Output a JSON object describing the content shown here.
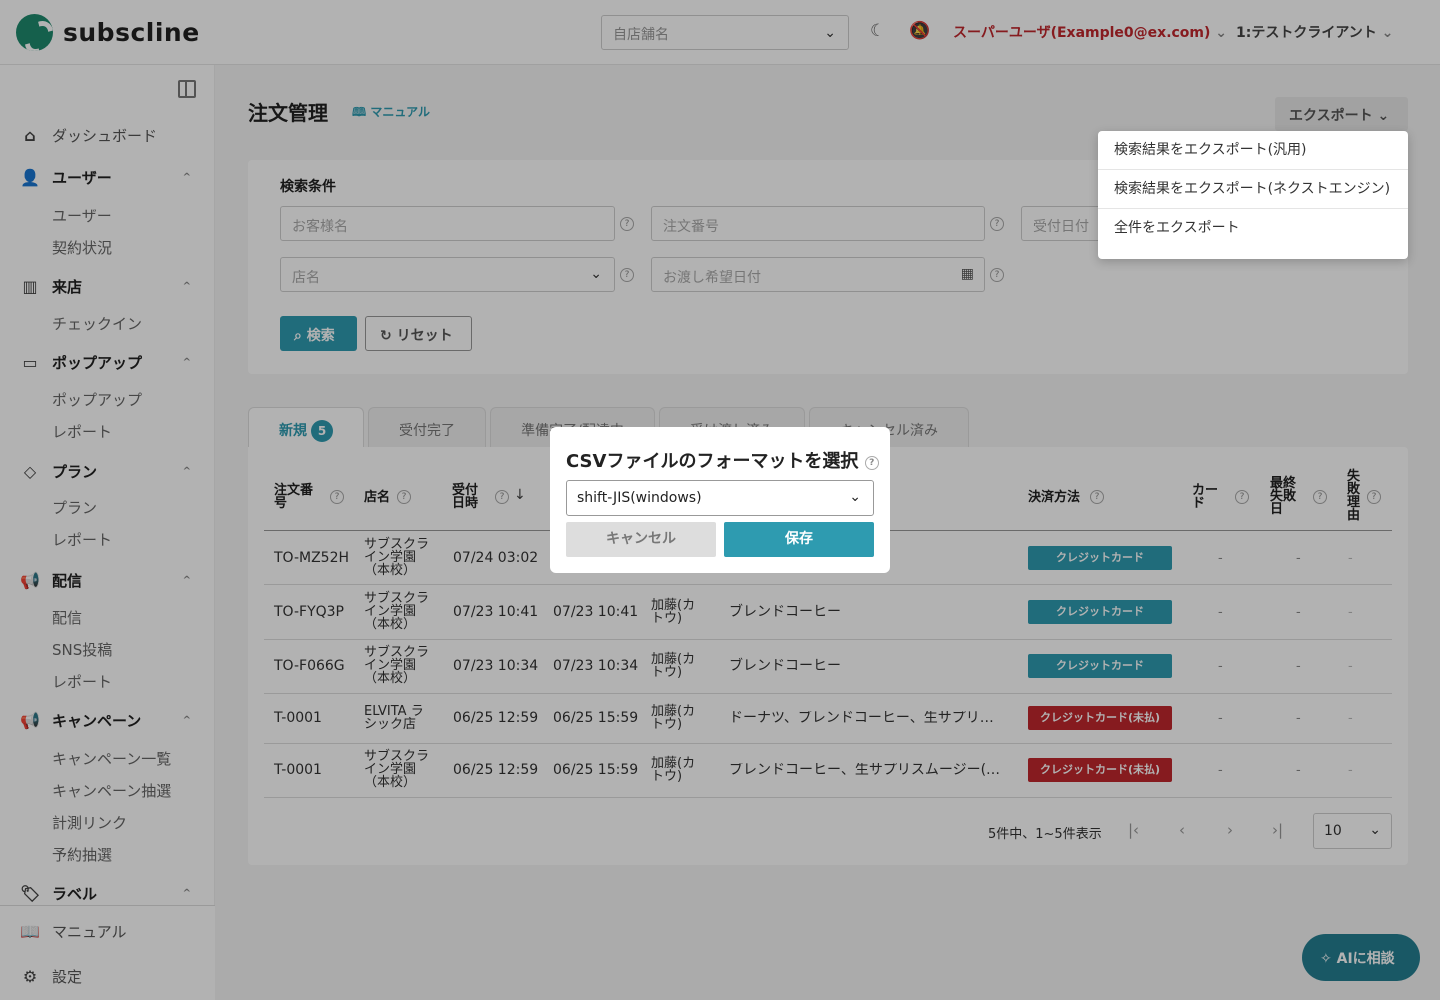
{
  "header": {
    "logo_text": "subscline",
    "store_placeholder": "自店舗名",
    "user_menu": "スーパーユーザ(Example0@ex.com)",
    "client_menu": "1:テストクライアント"
  },
  "sidebar": {
    "dashboard": "ダッシュボード",
    "groups": [
      {
        "label": "ユーザー",
        "items": [
          "ユーザー",
          "契約状況"
        ]
      },
      {
        "label": "来店",
        "items": [
          "チェックイン"
        ]
      },
      {
        "label": "ポップアップ",
        "items": [
          "ポップアップ",
          "レポート"
        ]
      },
      {
        "label": "プラン",
        "items": [
          "プラン",
          "レポート"
        ]
      },
      {
        "label": "配信",
        "items": [
          "配信",
          "SNS投稿",
          "レポート"
        ]
      },
      {
        "label": "キャンペーン",
        "items": [
          "キャンペーン一覧",
          "キャンペーン抽選",
          "計測リンク",
          "予約抽選"
        ]
      },
      {
        "label": "ラベル",
        "items": []
      }
    ],
    "bottom": [
      "マニュアル",
      "設定"
    ]
  },
  "page": {
    "title": "注文管理",
    "manual_link": "マニュアル",
    "export_label": "エクスポート"
  },
  "search": {
    "heading": "検索条件",
    "customer_placeholder": "お客様名",
    "order_no_placeholder": "注文番号",
    "received_date_placeholder": "受付日付",
    "store_placeholder": "店名",
    "pickup_date_placeholder": "お渡し希望日付",
    "search_button": "検索",
    "reset_button": "リセット"
  },
  "tabs": [
    {
      "label": "新規",
      "count": "5"
    },
    {
      "label": "受付完了"
    },
    {
      "label": "準備完了/配達中"
    },
    {
      "label": "受け渡し済み"
    },
    {
      "label": "キャンセル済み"
    }
  ],
  "table": {
    "headers": {
      "order_no": "注文番号",
      "store": "店名",
      "received": "受付日時",
      "payment": "決済方法",
      "card": "カード",
      "last_fail": "最終失敗日",
      "fail_reason": "失敗理由"
    },
    "rows": [
      {
        "order_no": "TO-MZ52H",
        "store": "サブスクライン学園（本校）",
        "received": "07/24 03:02",
        "pickup": "",
        "customer": "",
        "items": "",
        "payment": "クレジットカード",
        "status": "teal",
        "card": "-",
        "last_fail": "-",
        "fail_reason": "-"
      },
      {
        "order_no": "TO-FYQ3P",
        "store": "サブスクライン学園（本校）",
        "received": "07/23 10:41",
        "pickup": "07/23 10:41",
        "customer": "加藤(カトウ)",
        "items": "ブレンドコーヒー",
        "payment": "クレジットカード",
        "status": "teal",
        "card": "-",
        "last_fail": "-",
        "fail_reason": "-"
      },
      {
        "order_no": "TO-F066G",
        "store": "サブスクライン学園（本校）",
        "received": "07/23 10:34",
        "pickup": "07/23 10:34",
        "customer": "加藤(カトウ)",
        "items": "ブレンドコーヒー",
        "payment": "クレジットカード",
        "status": "teal",
        "card": "-",
        "last_fail": "-",
        "fail_reason": "-"
      },
      {
        "order_no": "T-0001",
        "store": "ELVITA ラシック店",
        "received": "06/25 12:59",
        "pickup": "06/25 15:59",
        "customer": "加藤(カトウ)",
        "items": "ドーナツ、ブレンドコーヒー、生サプリ…",
        "payment": "クレジットカード(未払)",
        "status": "red",
        "card": "-",
        "last_fail": "-",
        "fail_reason": "-"
      },
      {
        "order_no": "T-0001",
        "store": "サブスクライン学園（本校）",
        "received": "06/25 12:59",
        "pickup": "06/25 15:59",
        "customer": "加藤(カトウ)",
        "items": "ブレンドコーヒー、生サプリスムージー(…",
        "payment": "クレジットカード(未払)",
        "status": "red",
        "card": "-",
        "last_fail": "-",
        "fail_reason": "-"
      }
    ]
  },
  "pagination": {
    "summary": "5件中、1~5件表示",
    "per_page": "10"
  },
  "export_menu": [
    "検索結果をエクスポート(汎用)",
    "検索結果をエクスポート(ネクストエンジン)",
    "全件をエクスポート"
  ],
  "modal": {
    "title": "CSVファイルのフォーマットを選択",
    "selected_format": "shift-JIS(windows)",
    "cancel": "キャンセル",
    "save": "保存"
  },
  "ai_button": "AIに相談",
  "colors": {
    "accent": "#2e9bb0",
    "danger": "#c1272d"
  }
}
